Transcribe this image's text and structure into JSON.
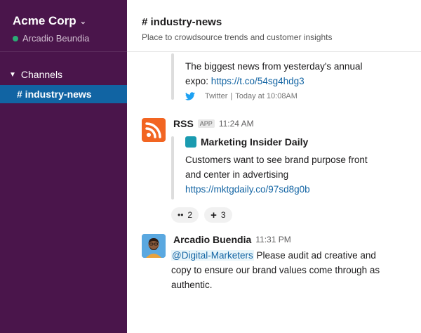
{
  "workspace": {
    "name": "Acme Corp",
    "user": "Arcadio Beundia"
  },
  "sidebar": {
    "section_label": "Channels",
    "active_channel": "# industry-news"
  },
  "channel": {
    "title": "# industry-news",
    "topic": "Place to crowdsource trends and customer insights"
  },
  "messages": {
    "tweet": {
      "line1": "The biggest news from yesterday's annual",
      "line2_prefix": "expo: ",
      "link": "https://t.co/54sg4hdg3",
      "source": "Twitter",
      "separator": "|",
      "time": "Today at 10:08AM"
    },
    "rss": {
      "sender": "RSS",
      "badge": "APP",
      "time": "11:24 AM",
      "attachment_title": "Marketing Insider Daily",
      "attachment_line1": "Customers want to see brand purpose front",
      "attachment_line2": "and center in advertising",
      "attachment_link": "https://mktgdaily.co/97sd8g0b",
      "reactions": [
        {
          "glyph": "••",
          "count": "2"
        },
        {
          "glyph": "+",
          "count": "3"
        }
      ]
    },
    "person": {
      "sender": "Arcadio Buendia",
      "time": "11:31 PM",
      "mention": "@Digital-Marketers",
      "line1_rest": " Please audit ad creative and",
      "line2": "copy to ensure our brand values come through as",
      "line3": "authentic."
    }
  },
  "colors": {
    "sidebar_bg": "#4a154b",
    "active_channel_bg": "#1164a3",
    "presence": "#2bac76",
    "link": "#1264a3",
    "rss_orange": "#f26522",
    "twitter_blue": "#1da1f2"
  },
  "icons": {
    "workspace_menu": "chevron-down-icon",
    "section_toggle": "caret-down-icon",
    "twitter": "twitter-bird-icon",
    "rss": "rss-feed-icon",
    "reaction_1": "eyes-emoji-icon",
    "reaction_2": "plus-icon"
  }
}
